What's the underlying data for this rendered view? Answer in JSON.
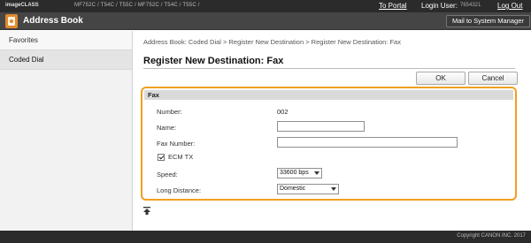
{
  "topbar": {
    "product": "imageCLASS",
    "model": "MF752C / T54C / T55C / MF752C / T54C / T55C /",
    "to_portal": "To Portal",
    "login_user_label": "Login User:",
    "login_user_value": "7654321",
    "log_out": "Log Out"
  },
  "titlebar": {
    "icon": "address-book-icon",
    "title": "Address Book",
    "mail_button": "Mail to System Manager"
  },
  "sidebar": {
    "items": [
      {
        "label": "Favorites",
        "active": false
      },
      {
        "label": "Coded Dial",
        "active": true
      }
    ]
  },
  "main": {
    "breadcrumb": "Address Book: Coded Dial > Register New Destination > Register New Destination: Fax",
    "title": "Register New Destination: Fax",
    "ok_label": "OK",
    "cancel_label": "Cancel"
  },
  "fax": {
    "header": "Fax",
    "number_label": "Number:",
    "number_value": "002",
    "name_label": "Name:",
    "name_value": "",
    "fax_number_label": "Fax Number:",
    "fax_number_value": "",
    "ecm_tx_label": "ECM TX",
    "ecm_tx_checked": true,
    "speed_label": "Speed:",
    "speed_value": "33600 bps",
    "long_distance_label": "Long Distance:",
    "long_distance_value": "Domestic"
  },
  "footer": {
    "copyright": "Copyright CANON INC. 2017"
  },
  "colors": {
    "highlight": "#f0a020",
    "topbar": "#2b2b2b",
    "titlebar": "#454545",
    "app_icon": "#e08a2b"
  }
}
